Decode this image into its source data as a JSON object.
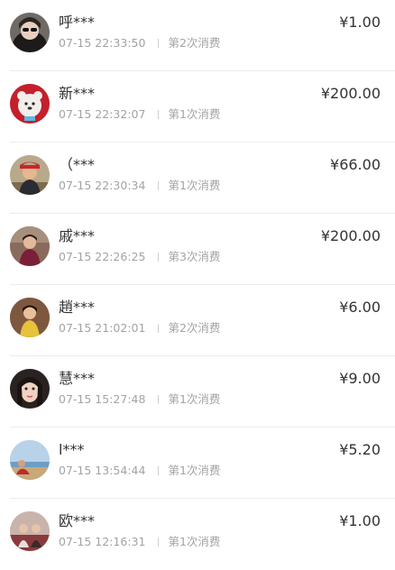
{
  "records": [
    {
      "name": "呼***",
      "time": "07-15 22:33:50",
      "count_label": "第2次消费",
      "amount": "¥1.00",
      "avatar_icon": "user-avatar-icon"
    },
    {
      "name": "新***",
      "time": "07-15 22:32:07",
      "count_label": "第1次消费",
      "amount": "¥200.00",
      "avatar_icon": "user-avatar-icon"
    },
    {
      "name": "（***",
      "time": "07-15 22:30:34",
      "count_label": "第1次消费",
      "amount": "¥66.00",
      "avatar_icon": "user-avatar-icon"
    },
    {
      "name": "戚***",
      "time": "07-15 22:26:25",
      "count_label": "第3次消费",
      "amount": "¥200.00",
      "avatar_icon": "user-avatar-icon"
    },
    {
      "name": "趙***",
      "time": "07-15 21:02:01",
      "count_label": "第2次消费",
      "amount": "¥6.00",
      "avatar_icon": "user-avatar-icon"
    },
    {
      "name": "慧***",
      "time": "07-15 15:27:48",
      "count_label": "第1次消费",
      "amount": "¥9.00",
      "avatar_icon": "user-avatar-icon"
    },
    {
      "name": "l***",
      "time": "07-15 13:54:44",
      "count_label": "第1次消费",
      "amount": "¥5.20",
      "avatar_icon": "user-avatar-icon"
    },
    {
      "name": "欧***",
      "time": "07-15 12:16:31",
      "count_label": "第1次消费",
      "amount": "¥1.00",
      "avatar_icon": "user-avatar-icon"
    }
  ]
}
